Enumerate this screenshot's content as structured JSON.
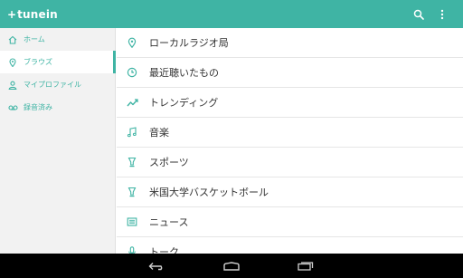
{
  "app": {
    "logo_text": "tunein",
    "logo_mark": "+"
  },
  "appbar": {
    "icons": [
      "search-icon",
      "overflow-menu-icon"
    ]
  },
  "sidebar": {
    "items": [
      {
        "label": "ホーム",
        "icon": "home-icon",
        "active": false
      },
      {
        "label": "ブラウズ",
        "icon": "location-pin-icon",
        "active": true
      },
      {
        "label": "マイプロファイル",
        "icon": "person-icon",
        "active": false
      },
      {
        "label": "録音済み",
        "icon": "cassette-icon",
        "active": false
      }
    ]
  },
  "browse": {
    "items": [
      {
        "label": "ローカルラジオ局",
        "icon": "location-pin-icon"
      },
      {
        "label": "最近聴いたもの",
        "icon": "clock-icon"
      },
      {
        "label": "トレンディング",
        "icon": "trending-icon"
      },
      {
        "label": "音楽",
        "icon": "music-note-icon"
      },
      {
        "label": "スポーツ",
        "icon": "trophy-icon"
      },
      {
        "label": "米国大学バスケットボール",
        "icon": "trophy-icon"
      },
      {
        "label": "ニュース",
        "icon": "newspaper-icon"
      },
      {
        "label": "トーク",
        "icon": "microphone-icon"
      }
    ]
  },
  "navbar": {
    "buttons": [
      "back-icon",
      "home-nav-icon",
      "recents-icon"
    ]
  },
  "colors": {
    "accent": "#3fb4a4",
    "text": "#333333",
    "sidebar_bg": "#f2f2f2",
    "navbar_bg": "#000000"
  }
}
